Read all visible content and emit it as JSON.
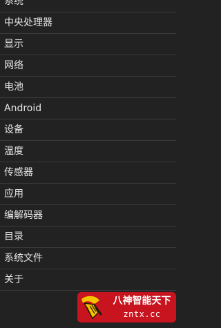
{
  "menu": {
    "items": [
      {
        "label": "系统"
      },
      {
        "label": "中央处理器"
      },
      {
        "label": "显示"
      },
      {
        "label": "网络"
      },
      {
        "label": "电池"
      },
      {
        "label": "Android"
      },
      {
        "label": "设备"
      },
      {
        "label": "温度"
      },
      {
        "label": "传感器"
      },
      {
        "label": "应用"
      },
      {
        "label": "编解码器"
      },
      {
        "label": "目录"
      },
      {
        "label": "系统文件"
      },
      {
        "label": "关于"
      }
    ]
  },
  "watermark": {
    "name": "八神智能天下",
    "domain": "zntx.cc",
    "logo_icon": "broom-logo-icon",
    "color": "#c8141e"
  },
  "colors": {
    "background": "#222222",
    "divider": "#3a3a3a",
    "text": "#e6e6e6"
  }
}
